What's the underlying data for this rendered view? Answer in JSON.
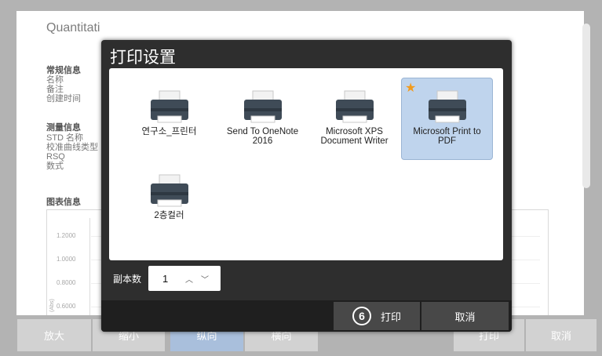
{
  "report": {
    "title": "Quantitati",
    "general_section": "常规信息",
    "general_fields": [
      "名称",
      "备注",
      "创建时间"
    ],
    "measure_section": "测量信息",
    "measure_fields": [
      "STD 名称",
      "校准曲线类型",
      "RSQ",
      "数式"
    ],
    "chart_section": "图表信息",
    "chart_ticks": [
      "1.2000",
      "1.0000",
      "0.8000",
      "0.6000"
    ],
    "chart_ylabel": "(Abs)"
  },
  "toolbar": {
    "zoom_in": "放大",
    "zoom_out": "缩小",
    "portrait": "纵向",
    "landscape": "横向",
    "print": "打印",
    "cancel": "取消"
  },
  "dialog": {
    "title": "打印设置",
    "printers": [
      {
        "label": "연구소_프린터",
        "default": false,
        "selected": false
      },
      {
        "label": "Send To OneNote 2016",
        "default": false,
        "selected": false
      },
      {
        "label": "Microsoft XPS Document Writer",
        "default": false,
        "selected": false
      },
      {
        "label": "Microsoft Print to PDF",
        "default": true,
        "selected": true
      },
      {
        "label": "2층컬러",
        "default": false,
        "selected": false
      }
    ],
    "copies_label": "副本数",
    "copies_value": "1",
    "step_number": "6",
    "print_button": "打印",
    "cancel_button": "取消"
  },
  "colors": {
    "selected_printer_bg": "#bfd4ed",
    "default_star": "#f29b1d",
    "dialog_bg": "#2e2e2e",
    "toolbar_highlight": "#a9bfdc"
  }
}
